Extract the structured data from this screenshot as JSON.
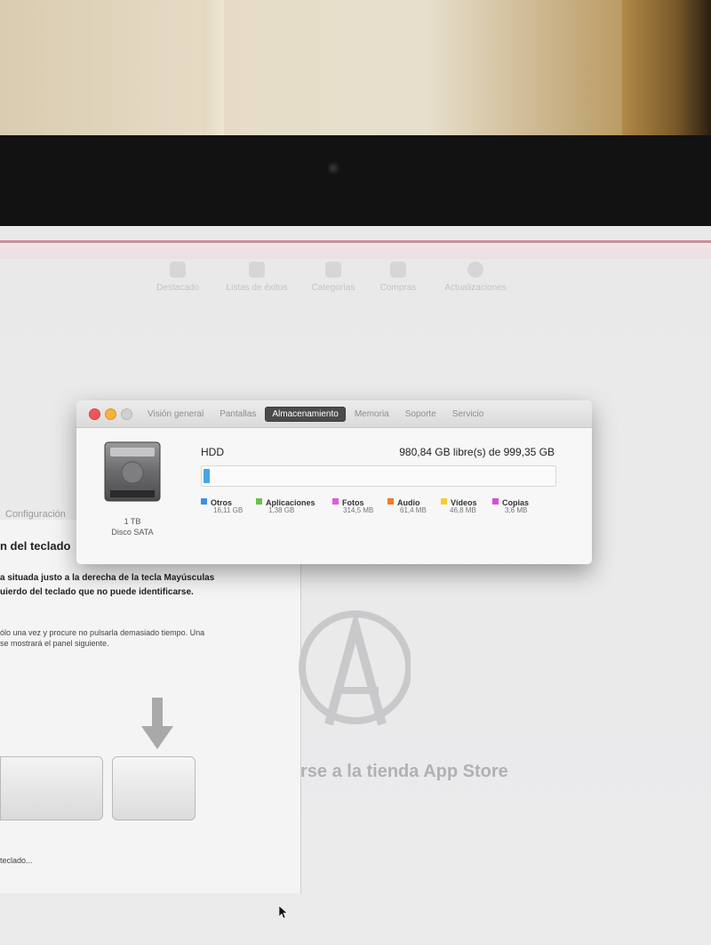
{
  "toolbar": {
    "items": [
      {
        "label": "Destacado",
        "icon": "star-icon"
      },
      {
        "label": "Listas de éxitos",
        "icon": "list-icon"
      },
      {
        "label": "Categorías",
        "icon": "grid-icon"
      },
      {
        "label": "Compras",
        "icon": "tag-icon"
      },
      {
        "label": "Actualizaciones",
        "icon": "refresh-icon"
      }
    ]
  },
  "keyboard_panel": {
    "tab": "Configuración",
    "title": "n del teclado",
    "line1": "a situada justo a la derecha de la tecla Mayúsculas",
    "line2": "uierdo del teclado que no puede identificarse.",
    "line3": "ólo una vez y procure no pulsarla demasiado tiempo. Una",
    "line4": "se mostrará el panel siguiente.",
    "footer": "teclado..."
  },
  "appstore": {
    "text": "rse a la tienda App Store"
  },
  "about_window": {
    "tabs": [
      "Visión general",
      "Pantallas",
      "Almacenamiento",
      "Memoria",
      "Soporte",
      "Servicio"
    ],
    "active_tab": "Almacenamiento",
    "disk": {
      "capacity": "1 TB",
      "type": "Disco SATA",
      "name": "HDD",
      "free": "980,84 GB libre(s) de 999,35 GB",
      "used_fraction": 0.0186
    },
    "legend": [
      {
        "label": "Otros",
        "value": "16,11 GB",
        "color": "#3f8fe0"
      },
      {
        "label": "Aplicaciones",
        "value": "1,38 GB",
        "color": "#6cc24a"
      },
      {
        "label": "Fotos",
        "value": "314,5 MB",
        "color": "#e45ad8"
      },
      {
        "label": "Audio",
        "value": "61,4 MB",
        "color": "#f07a2a"
      },
      {
        "label": "Vídeos",
        "value": "46,8 MB",
        "color": "#f2cf2c"
      },
      {
        "label": "Copias",
        "value": "3,6 MB",
        "color": "#d94fcf"
      }
    ]
  },
  "colors": {
    "screen_bg": "#eaeaeb",
    "active_tab": "#4a4a4c",
    "storage_bar": "#4aa3e6"
  }
}
